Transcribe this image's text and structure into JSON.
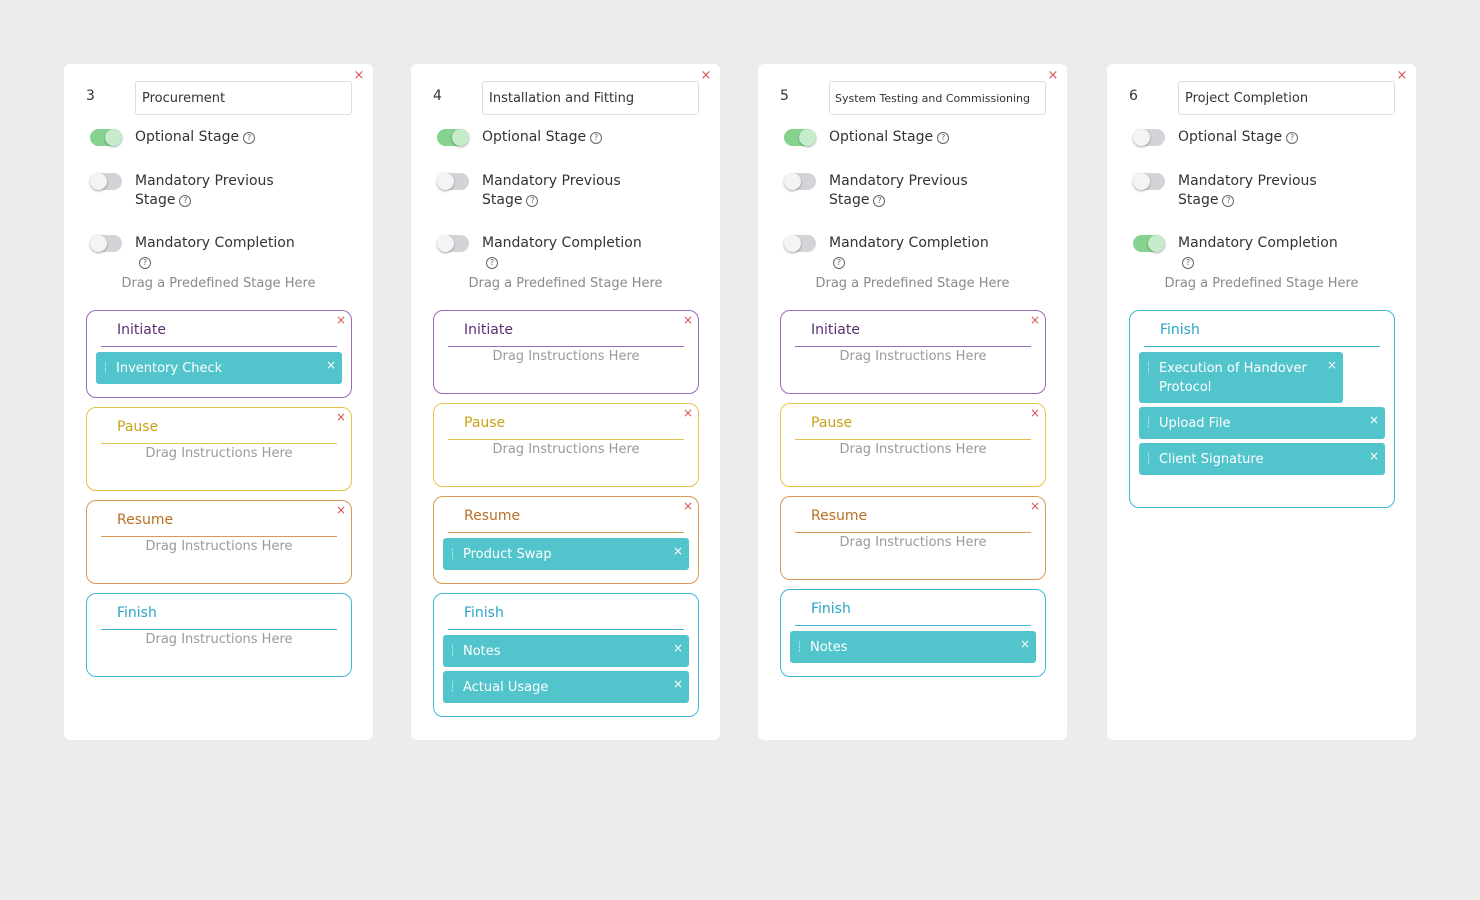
{
  "labels": {
    "optional_stage": "Optional Stage",
    "mandatory_previous_stage": "Mandatory Previous Stage",
    "mandatory_completion": "Mandatory Completion",
    "drag_stage_hint": "Drag a Predefined Stage Here",
    "drag_instructions_hint": "Drag Instructions Here",
    "close_glyph": "×",
    "help_glyph": "?"
  },
  "colors": {
    "initiate": "#9b6bb9",
    "pause": "#e7c24a",
    "resume": "#d99a56",
    "finish": "#3fb7d8",
    "instruction_chip": "#52c4cc",
    "toggle_on": "#86d38f",
    "close": "#d9534f"
  },
  "stages": [
    {
      "number": "3",
      "name": "Procurement",
      "optional_stage": true,
      "mandatory_previous_stage": false,
      "mandatory_completion": false,
      "phases": [
        {
          "key": "initiate",
          "title": "Initiate",
          "instructions": [
            "Inventory Check"
          ]
        },
        {
          "key": "pause",
          "title": "Pause",
          "instructions": []
        },
        {
          "key": "resume",
          "title": "Resume",
          "instructions": []
        },
        {
          "key": "finish",
          "title": "Finish",
          "instructions": []
        }
      ]
    },
    {
      "number": "4",
      "name": "Installation and Fitting",
      "optional_stage": true,
      "mandatory_previous_stage": false,
      "mandatory_completion": false,
      "phases": [
        {
          "key": "initiate",
          "title": "Initiate",
          "instructions": []
        },
        {
          "key": "pause",
          "title": "Pause",
          "instructions": []
        },
        {
          "key": "resume",
          "title": "Resume",
          "instructions": [
            "Product Swap"
          ]
        },
        {
          "key": "finish",
          "title": "Finish",
          "instructions": [
            "Notes",
            "Actual Usage"
          ]
        }
      ]
    },
    {
      "number": "5",
      "name": "System Testing and Commissioning",
      "optional_stage": true,
      "mandatory_previous_stage": false,
      "mandatory_completion": false,
      "phases": [
        {
          "key": "initiate",
          "title": "Initiate",
          "instructions": []
        },
        {
          "key": "pause",
          "title": "Pause",
          "instructions": []
        },
        {
          "key": "resume",
          "title": "Resume",
          "instructions": []
        },
        {
          "key": "finish",
          "title": "Finish",
          "instructions": [
            "Notes"
          ]
        }
      ]
    },
    {
      "number": "6",
      "name": "Project Completion",
      "optional_stage": false,
      "mandatory_previous_stage": false,
      "mandatory_completion": true,
      "phases": [
        {
          "key": "finish",
          "title": "Finish",
          "instructions": [
            "Execution of Handover Protocol",
            "Upload File",
            "Client Signature"
          ]
        }
      ]
    }
  ]
}
